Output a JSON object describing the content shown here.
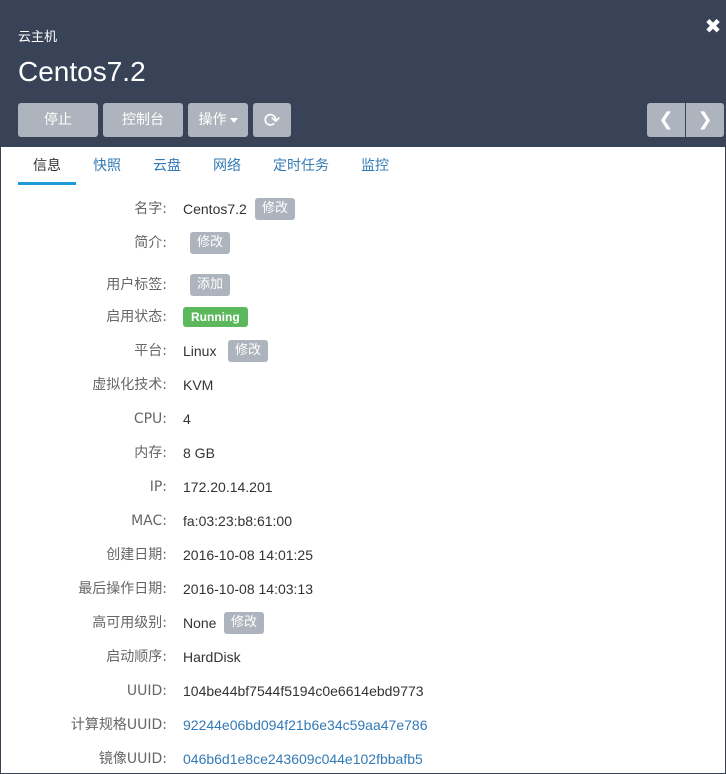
{
  "header": {
    "subtitle": "云主机",
    "title": "Centos7.2",
    "close_glyph": "✖",
    "buttons": {
      "stop": "停止",
      "console": "控制台",
      "actions": "操作",
      "refresh_icon": "refresh-icon",
      "refresh_glyph": "⟳",
      "prev_glyph": "❮",
      "next_glyph": "❯"
    }
  },
  "tabs": [
    {
      "label": "信息",
      "active": true
    },
    {
      "label": "快照"
    },
    {
      "label": "云盘"
    },
    {
      "label": "网络"
    },
    {
      "label": "定时任务"
    },
    {
      "label": "监控"
    }
  ],
  "info": {
    "name": {
      "label": "名字:",
      "value": "Centos7.2",
      "action": "修改"
    },
    "description": {
      "label": "简介:",
      "value": "",
      "action": "修改"
    },
    "user_tags": {
      "label": "用户标签:",
      "action": "添加"
    },
    "status": {
      "label": "启用状态:",
      "value": "Running"
    },
    "platform": {
      "label": "平台:",
      "value": "Linux",
      "action": "修改"
    },
    "virtualization": {
      "label": "虚拟化技术:",
      "value": "KVM"
    },
    "cpu": {
      "label": "CPU:",
      "value": "4"
    },
    "memory": {
      "label": "内存:",
      "value": "8 GB"
    },
    "ip": {
      "label": "IP:",
      "value": "172.20.14.201"
    },
    "mac": {
      "label": "MAC:",
      "value": "fa:03:23:b8:61:00"
    },
    "created": {
      "label": "创建日期:",
      "value": "2016-10-08 14:01:25"
    },
    "last_op": {
      "label": "最后操作日期:",
      "value": "2016-10-08 14:03:13"
    },
    "ha_level": {
      "label": "高可用级别:",
      "value": "None",
      "action": "修改"
    },
    "boot_order": {
      "label": "启动顺序:",
      "value": "HardDisk"
    },
    "uuid": {
      "label": "UUID:",
      "value": "104be44bf7544f5194c0e6614ebd9773"
    },
    "offering_uuid": {
      "label": "计算规格UUID:",
      "value": "92244e06bd094f21b6e34c59aa47e786"
    },
    "image_uuid": {
      "label": "镜像UUID:",
      "value": "046b6d1e8ce243609c044e102fbbafb5"
    }
  },
  "colors": {
    "header_bg": "#384357",
    "button_bg": "#aeb4bd",
    "tab_active_underline": "#1f9bd7",
    "link": "#337ab7",
    "status_running": "#5cb85c"
  }
}
